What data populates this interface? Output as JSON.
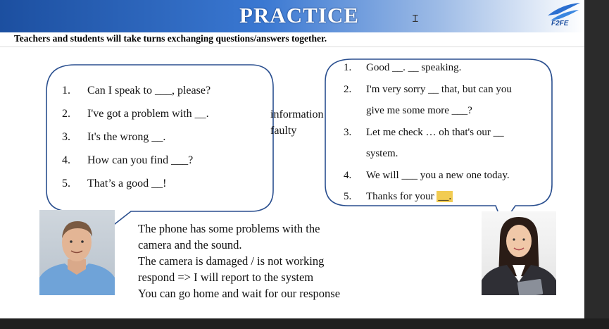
{
  "slide": {
    "title": "PRACTICE",
    "logo_text": "F2FE",
    "instruction": "Teachers and students will take turns exchanging questions/answers together."
  },
  "left_bubble": {
    "items": [
      {
        "num": "1.",
        "text": "Can I speak to ___, please?"
      },
      {
        "num": "2.",
        "text": "I've got a problem with __."
      },
      {
        "num": "3.",
        "text": "It's the wrong __."
      },
      {
        "num": "4.",
        "text": "How can you find ___?"
      },
      {
        "num": "5.",
        "text": "That’s a good __!"
      }
    ]
  },
  "word_bank": [
    "information",
    "faulty"
  ],
  "right_bubble": {
    "items": [
      {
        "num": "1.",
        "text": "Good __. __ speaking."
      },
      {
        "num": "2.",
        "text": "I'm very sorry __ that, but can you"
      },
      {
        "num": "",
        "text": "give me some more ___?"
      },
      {
        "num": "3.",
        "text": "Let me check … oh that's our __"
      },
      {
        "num": "",
        "text": "system."
      },
      {
        "num": "4.",
        "text": "We will ___ you a new one today."
      },
      {
        "num": "5.",
        "text": "Thanks for your",
        "highlight": "__."
      }
    ]
  },
  "notes": [
    "The phone has some problems with the",
    "camera and the sound.",
    "The camera is damaged / is not working",
    "respond => I will report to the system",
    "You can go home and wait for our response"
  ],
  "colors": {
    "header_dark": "#1c4fa0",
    "header_light": "#9dbbe6",
    "bubble_stroke": "#2a4f8f",
    "highlight": "#f2cc52"
  }
}
